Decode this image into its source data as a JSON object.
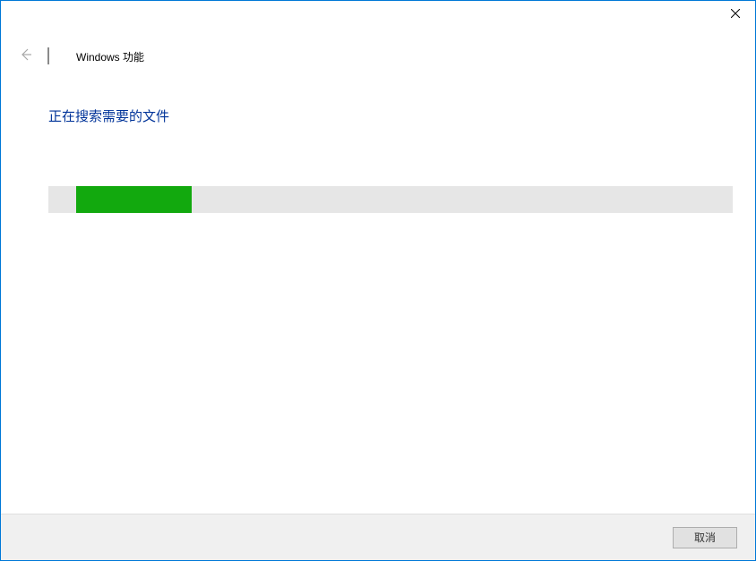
{
  "titlebar": {
    "close_icon": "close"
  },
  "header": {
    "back_icon": "back-arrow",
    "app_icon": "windows-features-icon",
    "title": "Windows 功能"
  },
  "main": {
    "status_heading": "正在搜索需要的文件",
    "progress": {
      "offset_percent": 4,
      "fill_percent": 17,
      "fill_color": "#12a90e",
      "track_color": "#e6e6e6"
    }
  },
  "footer": {
    "cancel_label": "取消"
  }
}
